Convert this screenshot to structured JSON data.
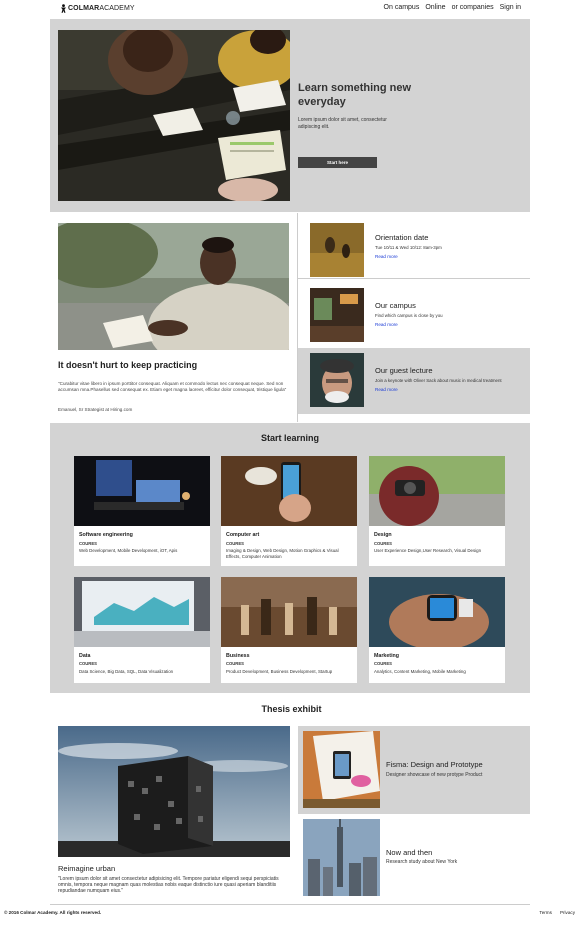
{
  "header": {
    "logo_bold": "COLMAR",
    "logo_light": "ACADEMY",
    "nav": [
      "On campus",
      "Online",
      "or companies",
      "Sign in"
    ]
  },
  "hero": {
    "title": "Learn something new everyday",
    "text": "Lorem ipsum dolor sit amet, consectetur adipiscing elit.",
    "button": "Start here"
  },
  "feature": {
    "title": "It doesn't hurt to keep practicing",
    "quote": "\"Curabitur vitae libero in ipsum porttitor consequat. Aliquam et commodo lectus nec consequat neque. Sed non accumsan mna.Phasellus sed consequat ex. Etiam eget magna laoreet, efficitur dolor consequat, tristique ligula\"",
    "cite": "Emanuel, Sr Strategist at Hiring.com"
  },
  "events": [
    {
      "title": "Orientation date",
      "desc": "Tue 10/11 & Wed 10/12: 8am-3pm",
      "link": "Read more"
    },
    {
      "title": "Our campus",
      "desc": "Find which campus is close by you",
      "link": "Read more"
    },
    {
      "title": "Our guest lecture",
      "desc": "Join a keynote with Oliver Sack about music in medical treatment",
      "link": "Read more"
    }
  ],
  "learn": {
    "title": "Start learning",
    "courses": [
      {
        "name": "Software engineering",
        "kind": "COURES",
        "tags": "Web Development, Mobile Development, iOT, Apis"
      },
      {
        "name": "Computer art",
        "kind": "COURES",
        "tags": "Imaging & Design, Web Design, Motion Graphics & Visual Effects, Computer Animation"
      },
      {
        "name": "Design",
        "kind": "COURES",
        "tags": "User Experience Design,User Research, Visual Design"
      },
      {
        "name": "Data",
        "kind": "COURES",
        "tags": "Data Science, Big Data, SQL, Data Visualization"
      },
      {
        "name": "Business",
        "kind": "COURES",
        "tags": "Product Development, Business Development, Startup"
      },
      {
        "name": "Marketing",
        "kind": "COURES",
        "tags": "Analytics, Content Marketing, Mobile Marketing"
      }
    ]
  },
  "thesis": {
    "title": "Thesis exhibit",
    "caption": "Reimagine urban",
    "text": "\"Lorem ipsum dolor sit amet consectetur adipisicing elit. Tempore pariatur eligendi sequi perspiciatis omnis, tempora neque magnam quas molestias nobis eaque distinctio iure quasi aperiam blanditiis repudiandae numquam eius.\"",
    "projects": [
      {
        "title": "Fisma: Design and Prototype",
        "desc": "Designer showcase of new protype Product"
      },
      {
        "title": "Now and then",
        "desc": "Research study about New York"
      }
    ]
  },
  "footer": {
    "copyright": "© 2016 Colmar Academy. All rights reserved.",
    "links": [
      "Terms",
      "Privacy"
    ]
  },
  "colors": {
    "panel": "#d3d3d3",
    "button": "#444444",
    "link": "#1a3bd6"
  }
}
